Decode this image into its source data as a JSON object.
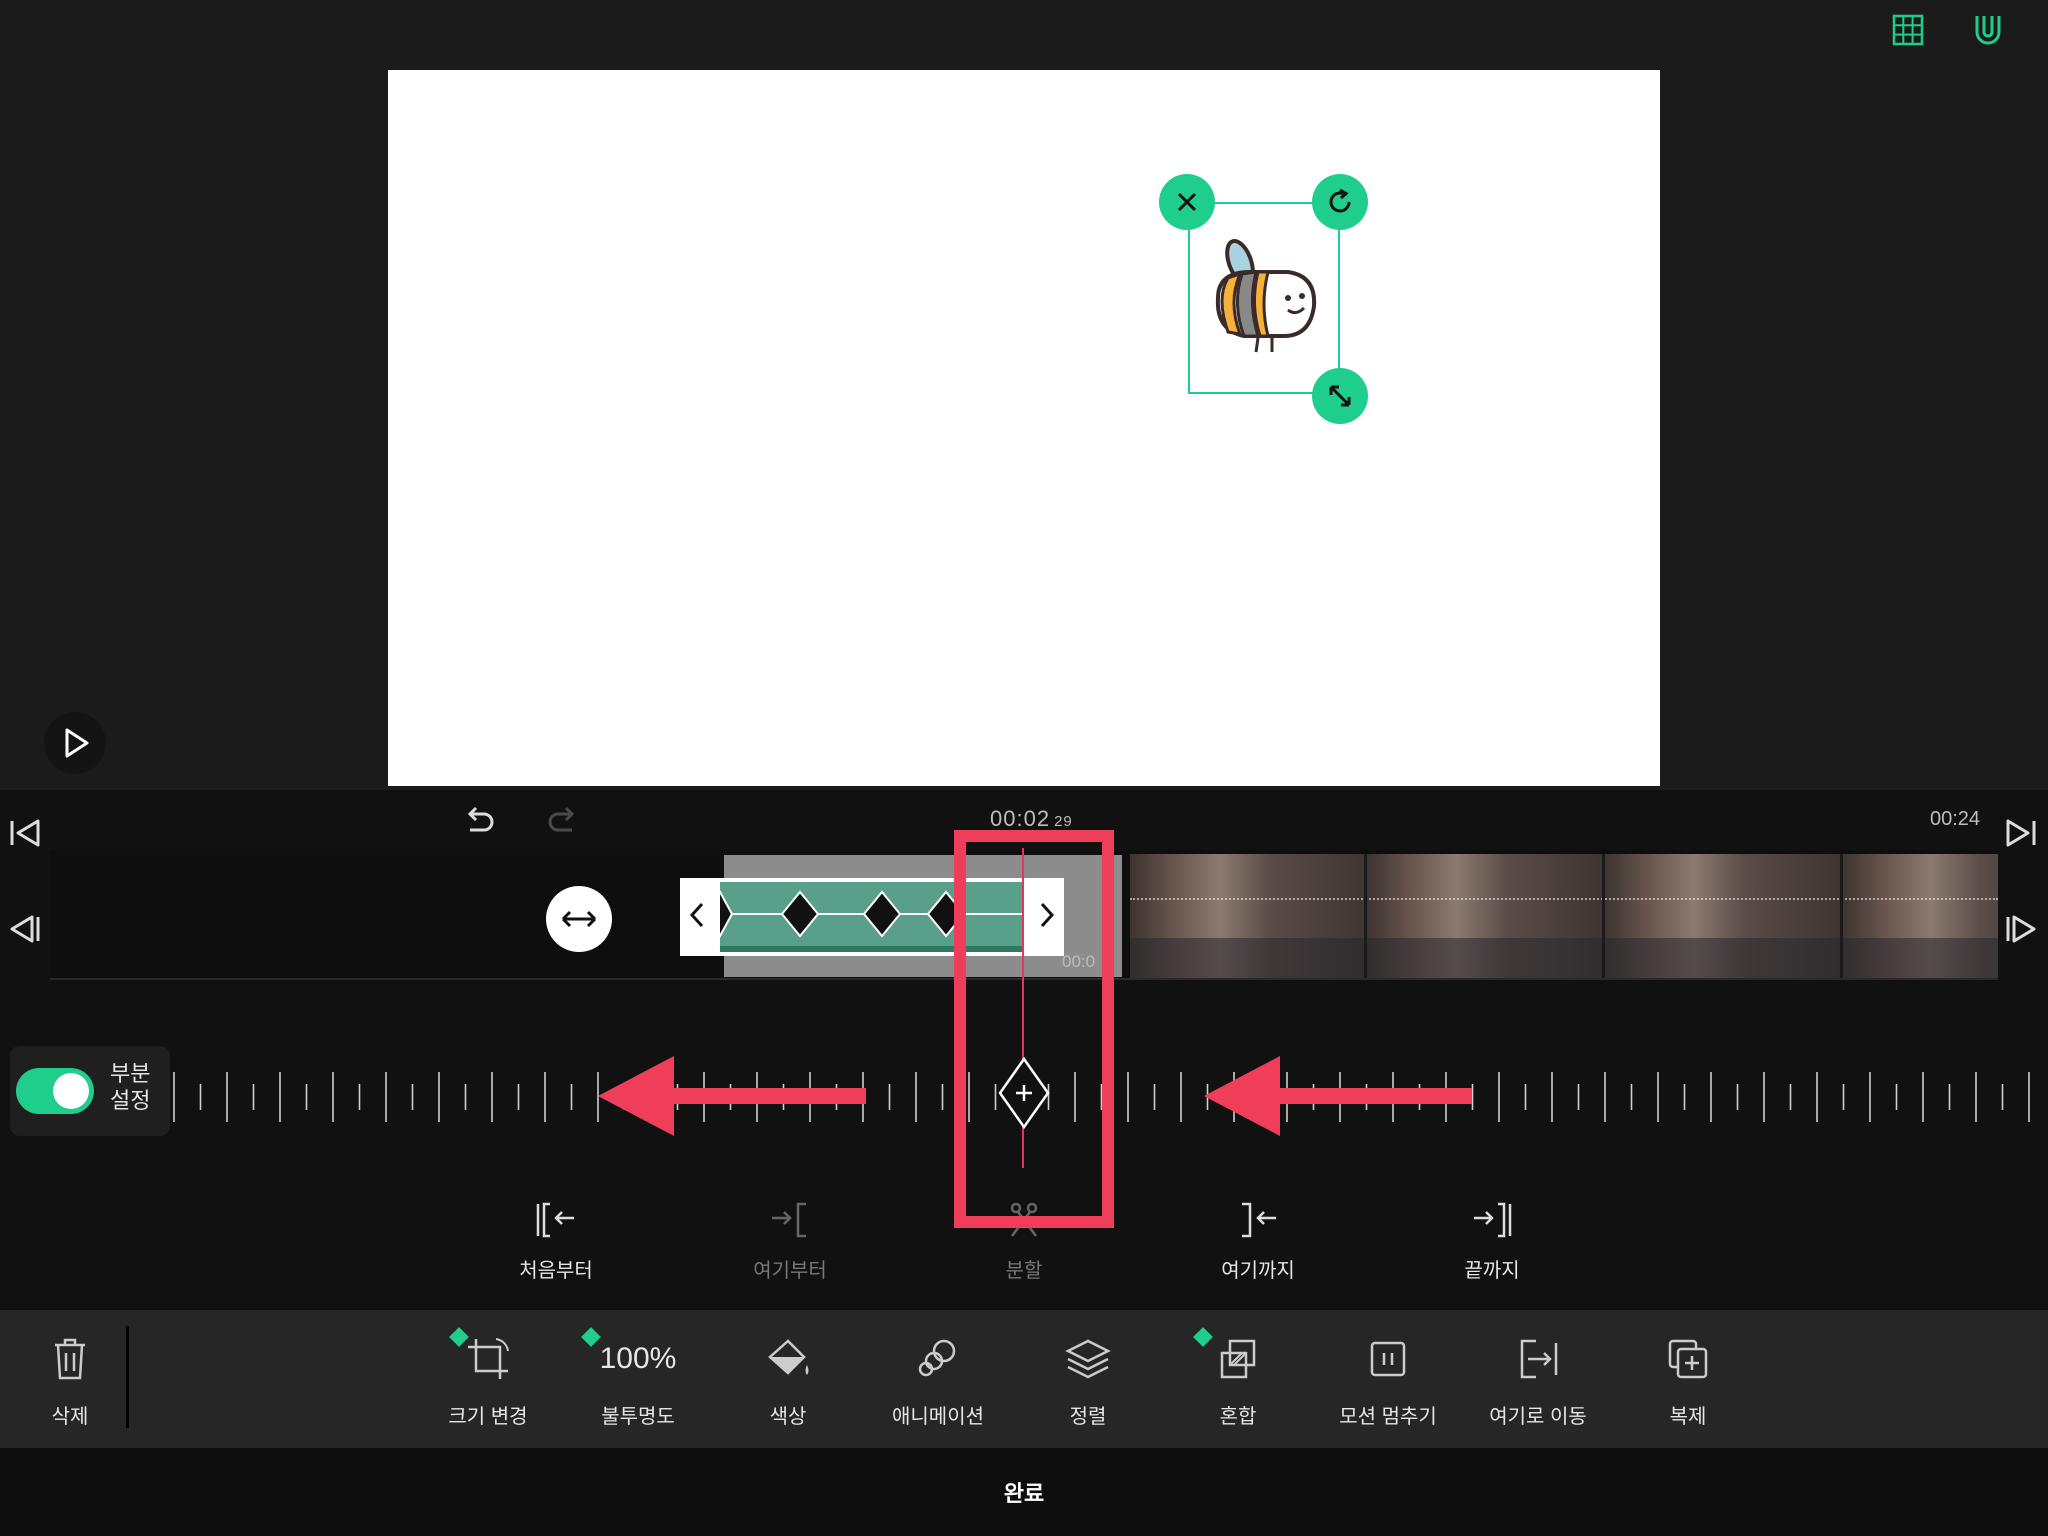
{
  "preview": {
    "top_icons": [
      "grid-icon",
      "magnet-icon"
    ],
    "sticker": {
      "handles": [
        "close-icon",
        "rotate-icon",
        "resize-icon"
      ]
    }
  },
  "timeline": {
    "current_time": "00:02",
    "current_frames": "29",
    "total_time": "00:24",
    "clip_time": "00:0",
    "keyframe_count": 4
  },
  "subsection": {
    "label": "부분\n설정",
    "enabled": true
  },
  "edit_tools": [
    {
      "label": "처음부터",
      "enabled": true
    },
    {
      "label": "여기부터",
      "enabled": false
    },
    {
      "label": "분할",
      "enabled": false
    },
    {
      "label": "여기까지",
      "enabled": true
    },
    {
      "label": "끝까지",
      "enabled": true
    }
  ],
  "toolbar": {
    "delete_label": "삭제",
    "resize_label": "크기 변경",
    "opacity_value": "100%",
    "opacity_label": "불투명도",
    "color_label": "색상",
    "animation_label": "애니메이션",
    "arrange_label": "정렬",
    "blend_label": "혼합",
    "freeze_label": "모션 멈추기",
    "move_here_label": "여기로 이동",
    "duplicate_label": "복제"
  },
  "done_label": "완료",
  "colors": {
    "accent": "#1fce8d",
    "highlight": "#f03e5a",
    "playhead": "#e8335a"
  }
}
